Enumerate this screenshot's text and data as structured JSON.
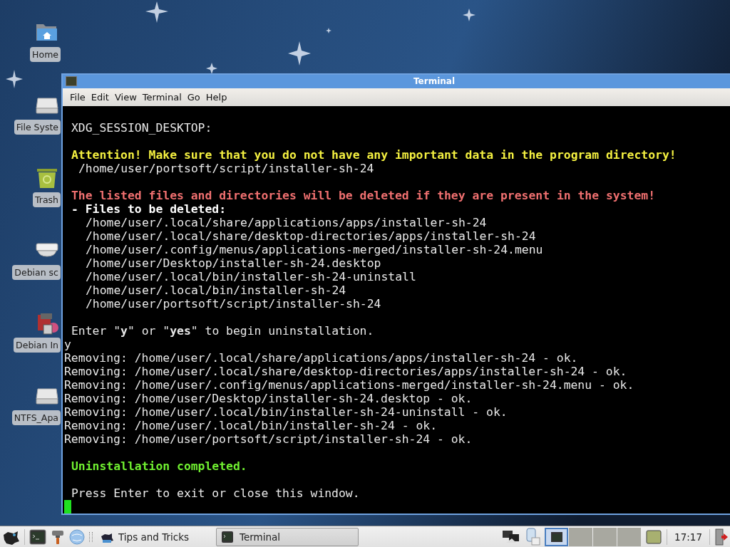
{
  "desktop_icons": [
    {
      "kind": "folder",
      "label": "Home"
    },
    {
      "kind": "drive",
      "label": "File Syste"
    },
    {
      "kind": "trash",
      "label": "Trash"
    },
    {
      "kind": "optical",
      "label": "Debian sc"
    },
    {
      "kind": "installer",
      "label": "Debian In"
    },
    {
      "kind": "drive",
      "label": "NTFS_Apa"
    }
  ],
  "window": {
    "title": "Terminal",
    "menu": [
      {
        "label": "File"
      },
      {
        "label": "Edit"
      },
      {
        "label": "View"
      },
      {
        "label": "Terminal"
      },
      {
        "label": "Go"
      },
      {
        "label": "Help"
      }
    ],
    "lines": [
      {
        "kind": "msg",
        "gap_before": false,
        "text": "XDG_SESSION_DESKTOP:"
      },
      {
        "kind": "warning",
        "gap_before": true,
        "text": "Attention! Make sure that you do not have any important data in the program directory!"
      },
      {
        "kind": "sub",
        "gap_before": false,
        "text": "/home/user/portsoft/script/installer-sh-24"
      },
      {
        "kind": "danger",
        "gap_before": true,
        "text": "The listed files and directories will be deleted if they are present in the system!"
      },
      {
        "kind": "heading",
        "gap_before": false,
        "text": "- Files to be deleted:"
      },
      {
        "kind": "path",
        "gap_before": false,
        "text": "/home/user/.local/share/applications/apps/installer-sh-24"
      },
      {
        "kind": "path",
        "gap_before": false,
        "text": "/home/user/.local/share/desktop-directories/apps/installer-sh-24"
      },
      {
        "kind": "path",
        "gap_before": false,
        "text": "/home/user/.config/menus/applications-merged/installer-sh-24.menu"
      },
      {
        "kind": "path",
        "gap_before": false,
        "text": "/home/user/Desktop/installer-sh-24.desktop"
      },
      {
        "kind": "path",
        "gap_before": false,
        "text": "/home/user/.local/bin/installer-sh-24-uninstall"
      },
      {
        "kind": "path",
        "gap_before": false,
        "text": "/home/user/.local/bin/installer-sh-24"
      },
      {
        "kind": "path",
        "gap_before": false,
        "text": "/home/user/portsoft/script/installer-sh-24"
      },
      {
        "kind": "msg",
        "gap_before": true,
        "text": "Enter \"**y**\" or \"**yes**\" to begin uninstallation."
      },
      {
        "kind": "plain",
        "gap_before": false,
        "text": "y"
      },
      {
        "kind": "plain",
        "gap_before": false,
        "text": "Removing: /home/user/.local/share/applications/apps/installer-sh-24 - ok."
      },
      {
        "kind": "plain",
        "gap_before": false,
        "text": "Removing: /home/user/.local/share/desktop-directories/apps/installer-sh-24 - ok."
      },
      {
        "kind": "plain",
        "gap_before": false,
        "text": "Removing: /home/user/.config/menus/applications-merged/installer-sh-24.menu - ok."
      },
      {
        "kind": "plain",
        "gap_before": false,
        "text": "Removing: /home/user/Desktop/installer-sh-24.desktop - ok."
      },
      {
        "kind": "plain",
        "gap_before": false,
        "text": "Removing: /home/user/.local/bin/installer-sh-24-uninstall - ok."
      },
      {
        "kind": "plain",
        "gap_before": false,
        "text": "Removing: /home/user/.local/bin/installer-sh-24 - ok."
      },
      {
        "kind": "plain",
        "gap_before": false,
        "text": "Removing: /home/user/portsoft/script/installer-sh-24 - ok."
      },
      {
        "kind": "success",
        "gap_before": true,
        "text": "Uninstallation completed."
      },
      {
        "kind": "msg",
        "gap_before": true,
        "text": "Press Enter to exit or close this window."
      }
    ]
  },
  "taskbar": {
    "launcher_label": "Tips and Tricks",
    "tasks": [
      {
        "label": "Terminal",
        "selected": true
      }
    ],
    "workspaces": [
      {
        "selected": true
      },
      {
        "selected": false
      },
      {
        "selected": false
      },
      {
        "selected": false
      }
    ],
    "clock": "17:17"
  }
}
